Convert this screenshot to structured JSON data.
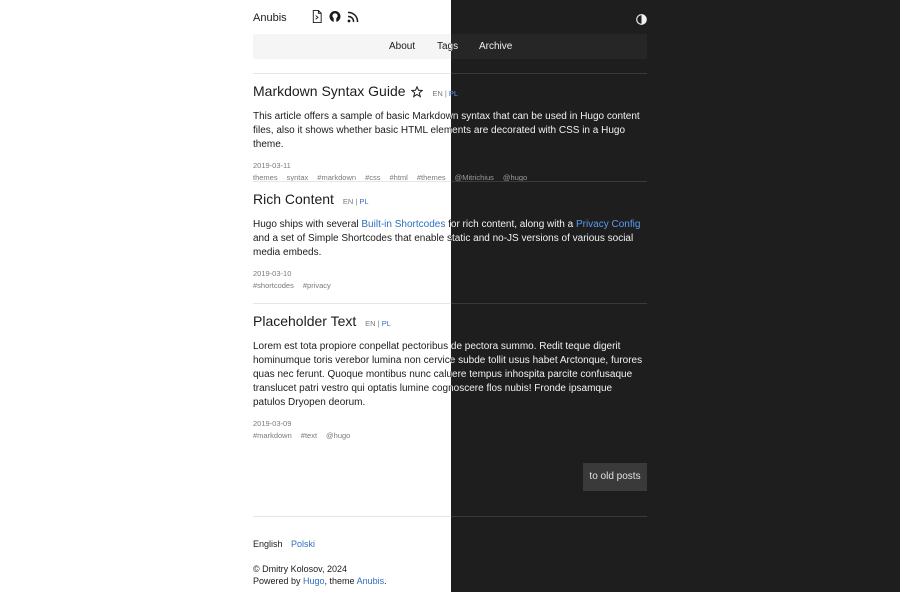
{
  "site": {
    "title": "Anubis"
  },
  "header": {
    "icons": [
      "document-icon",
      "github-icon",
      "rss-icon"
    ],
    "theme_toggle_icon": "half-circle-icon"
  },
  "nav": {
    "about": "About",
    "tags": "Tags",
    "archive": "Archive"
  },
  "posts": [
    {
      "title": "Markdown Syntax Guide",
      "lang_en": "EN",
      "lang_sep": "|",
      "lang_pl": "PL",
      "summary": "This article offers a sample of basic Markdown syntax that can be used in Hugo content files, also it shows whether basic HTML elements are decorated with CSS in a Hugo theme.",
      "date": "2019-03-11",
      "tags": [
        "themes",
        "syntax",
        "#markdown",
        "#css",
        "#html",
        "#themes",
        "@Mitrichius",
        "@hugo"
      ]
    },
    {
      "title": "Rich Content",
      "lang_en": "EN",
      "lang_sep": "|",
      "lang_pl": "PL",
      "summary_1": "Hugo ships with several ",
      "summary_link_1": "Built-in Shortcodes",
      "summary_2": " for rich content, along with a ",
      "summary_link_2": "Privacy Config",
      "summary_3": " and a set of Simple Shortcodes that enable static and no-JS versions of various social media embeds.",
      "date": "2019-03-10",
      "tags": [
        "#shortcodes",
        "#privacy"
      ]
    },
    {
      "title": "Placeholder Text",
      "lang_en": "EN",
      "lang_sep": "|",
      "lang_pl": "PL",
      "summary": "Lorem est tota propiore conpellat pectoribus de pectora summo. Redit teque digerit hominumque toris verebor lumina non cervice subde tollit usus habet Arctonque, furores quas nec ferunt. Quoque montibus nunc caluere tempus inhospita parcite confusaque translucet patri vestro qui optatis lumine cognoscere flos nubis! Fronde ipsamque patulos Dryopen deorum.",
      "date": "2019-03-09",
      "tags": [
        "#markdown",
        "#text",
        "@hugo"
      ]
    }
  ],
  "pagination": {
    "older": "to old posts"
  },
  "footer": {
    "lang_en": "English",
    "lang_pl": "Polski",
    "copyright": "© Dmitry Kolosov, 2024",
    "powered_prefix": "Powered by ",
    "hugo": "Hugo",
    "theme_prefix": ", theme ",
    "theme": "Anubis",
    "end": "."
  }
}
